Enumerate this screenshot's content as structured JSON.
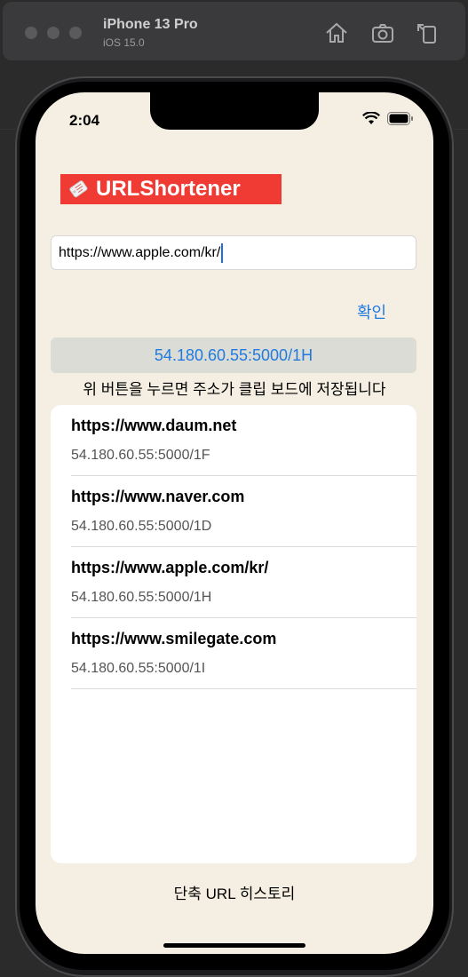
{
  "simulator": {
    "device": "iPhone 13 Pro",
    "os": "iOS 15.0"
  },
  "status_bar": {
    "time": "2:04"
  },
  "app": {
    "logo_text": "URLShortener"
  },
  "input": {
    "value": "https://www.apple.com/kr/"
  },
  "confirm_label": "확인",
  "shortened_url": "54.180.60.55:5000/1H",
  "hint": "위 버튼을 누르면 주소가 클립 보드에 저장됩니다",
  "history": [
    {
      "url": "https://www.daum.net",
      "short": "54.180.60.55:5000/1F"
    },
    {
      "url": "https://www.naver.com",
      "short": "54.180.60.55:5000/1D"
    },
    {
      "url": "https://www.apple.com/kr/",
      "short": "54.180.60.55:5000/1H"
    },
    {
      "url": "https://www.smilegate.com",
      "short": "54.180.60.55:5000/1I"
    }
  ],
  "footer_title": "단축 URL 히스토리",
  "colors": {
    "background": "#f4efe2",
    "accent": "#1f7ae0",
    "logo_bg": "#f03a34"
  }
}
